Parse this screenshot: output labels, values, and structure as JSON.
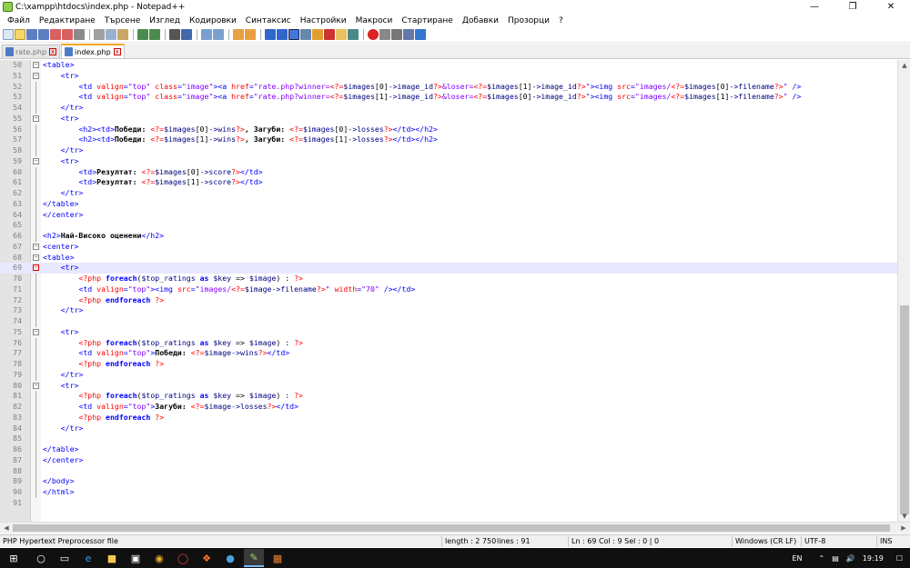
{
  "window": {
    "title": "C:\\xampp\\htdocs\\index.php - Notepad++"
  },
  "menu": [
    "Файл",
    "Редактиране",
    "Търсене",
    "Изглед",
    "Кодировки",
    "Синтаксис",
    "Настройки",
    "Макроси",
    "Стартиране",
    "Добавки",
    "Прозорци",
    "?"
  ],
  "tabs": [
    {
      "label": "rate.php"
    },
    {
      "label": "index.php"
    }
  ],
  "editor": {
    "current_line": 69,
    "lines": [
      {
        "n": "50",
        "h": "<span class=\"tag\">&lt;table&gt;</span>"
      },
      {
        "n": "51",
        "h": "    <span class=\"tag\">&lt;tr&gt;</span>"
      },
      {
        "n": "52",
        "h": "        <span class=\"tag\">&lt;td</span> <span class=\"attr\">valign</span><span class=\"tag\">=</span><span class=\"val\">\"top\"</span> <span class=\"attr\">class</span><span class=\"tag\">=</span><span class=\"val\">\"image\"</span><span class=\"tag\">&gt;&lt;a</span> <span class=\"attr\">href</span><span class=\"tag\">=</span><span class=\"val\">\"rate.php?winner=</span><span class=\"php\">&lt;?=</span><span class=\"var\">$images</span>[0]<span class=\"var\">-&gt;image_id</span><span class=\"php\">?&gt;</span><span class=\"val\">&amp;loser=</span><span class=\"php\">&lt;?=</span><span class=\"var\">$images</span>[1]<span class=\"var\">-&gt;image_id</span><span class=\"php\">?&gt;</span><span class=\"val\">\"</span><span class=\"tag\">&gt;&lt;img</span> <span class=\"attr\">src</span><span class=\"tag\">=</span><span class=\"val\">\"images/</span><span class=\"php\">&lt;?=</span><span class=\"var\">$images</span>[0]<span class=\"var\">-&gt;filename</span><span class=\"php\">?&gt;</span><span class=\"val\">\"</span> <span class=\"tag\">/&gt;</span>"
      },
      {
        "n": "53",
        "h": "        <span class=\"tag\">&lt;td</span> <span class=\"attr\">valign</span><span class=\"tag\">=</span><span class=\"val\">\"top\"</span> <span class=\"attr\">class</span><span class=\"tag\">=</span><span class=\"val\">\"image\"</span><span class=\"tag\">&gt;&lt;a</span> <span class=\"attr\">href</span><span class=\"tag\">=</span><span class=\"val\">\"rate.php?winner=</span><span class=\"php\">&lt;?=</span><span class=\"var\">$images</span>[1]<span class=\"var\">-&gt;image_id</span><span class=\"php\">?&gt;</span><span class=\"val\">&amp;loser=</span><span class=\"php\">&lt;?=</span><span class=\"var\">$images</span>[0]<span class=\"var\">-&gt;image_id</span><span class=\"php\">?&gt;</span><span class=\"val\">\"</span><span class=\"tag\">&gt;&lt;img</span> <span class=\"attr\">src</span><span class=\"tag\">=</span><span class=\"val\">\"images/</span><span class=\"php\">&lt;?=</span><span class=\"var\">$images</span>[1]<span class=\"var\">-&gt;filename</span><span class=\"php\">?&gt;</span><span class=\"val\">\"</span> <span class=\"tag\">/&gt;</span>"
      },
      {
        "n": "54",
        "h": "    <span class=\"tag\">&lt;/tr&gt;</span>"
      },
      {
        "n": "55",
        "h": "    <span class=\"tag\">&lt;tr&gt;</span>"
      },
      {
        "n": "56",
        "h": "        <span class=\"tag\">&lt;h2&gt;&lt;td&gt;</span><span class=\"txt\">Победи: </span><span class=\"php\">&lt;?=</span><span class=\"var\">$images</span>[0]<span class=\"var\">-&gt;wins</span><span class=\"php\">?&gt;</span><span class=\"txt\">, Загуби: </span><span class=\"php\">&lt;?=</span><span class=\"var\">$images</span>[0]<span class=\"var\">-&gt;losses</span><span class=\"php\">?&gt;</span><span class=\"tag\">&lt;/td&gt;&lt;/h2&gt;</span>"
      },
      {
        "n": "57",
        "h": "        <span class=\"tag\">&lt;h2&gt;&lt;td&gt;</span><span class=\"txt\">Победи: </span><span class=\"php\">&lt;?=</span><span class=\"var\">$images</span>[1]<span class=\"var\">-&gt;wins</span><span class=\"php\">?&gt;</span><span class=\"txt\">, Загуби: </span><span class=\"php\">&lt;?=</span><span class=\"var\">$images</span>[1]<span class=\"var\">-&gt;losses</span><span class=\"php\">?&gt;</span><span class=\"tag\">&lt;/td&gt;&lt;/h2&gt;</span>"
      },
      {
        "n": "58",
        "h": "    <span class=\"tag\">&lt;/tr&gt;</span>"
      },
      {
        "n": "59",
        "h": "    <span class=\"tag\">&lt;tr&gt;</span>"
      },
      {
        "n": "60",
        "h": "        <span class=\"tag\">&lt;td&gt;</span><span class=\"txt\">Резултат: </span><span class=\"php\">&lt;?=</span><span class=\"var\">$images</span>[0]<span class=\"var\">-&gt;score</span><span class=\"php\">?&gt;</span><span class=\"tag\">&lt;/td&gt;</span>"
      },
      {
        "n": "61",
        "h": "        <span class=\"tag\">&lt;td&gt;</span><span class=\"txt\">Резултат: </span><span class=\"php\">&lt;?=</span><span class=\"var\">$images</span>[1]<span class=\"var\">-&gt;score</span><span class=\"php\">?&gt;</span><span class=\"tag\">&lt;/td&gt;</span>"
      },
      {
        "n": "62",
        "h": "    <span class=\"tag\">&lt;/tr&gt;</span>"
      },
      {
        "n": "63",
        "h": "<span class=\"tag\">&lt;/table&gt;</span>"
      },
      {
        "n": "64",
        "h": "<span class=\"tag\">&lt;/center&gt;</span>"
      },
      {
        "n": "65",
        "h": ""
      },
      {
        "n": "66",
        "h": "<span class=\"tag\">&lt;h2&gt;</span><span class=\"txt\">Най-Високо оценени</span><span class=\"tag\">&lt;/h2&gt;</span>"
      },
      {
        "n": "67",
        "h": "<span class=\"tag\">&lt;center&gt;</span>"
      },
      {
        "n": "68",
        "h": "<span class=\"tag\">&lt;table&gt;</span>"
      },
      {
        "n": "69",
        "h": "    <span class=\"tag\">&lt;tr&gt;</span>"
      },
      {
        "n": "70",
        "h": "        <span class=\"php\">&lt;?php</span> <span class=\"kw\">foreach</span>(<span class=\"var\">$top_ratings</span> <span class=\"kw\">as</span> <span class=\"var\">$key</span> =&gt; <span class=\"var\">$image</span>) : <span class=\"php\">?&gt;</span>"
      },
      {
        "n": "71",
        "h": "        <span class=\"tag\">&lt;td</span> <span class=\"attr\">valign</span><span class=\"tag\">=</span><span class=\"val\">\"top\"</span><span class=\"tag\">&gt;&lt;img</span> <span class=\"attr\">src</span><span class=\"tag\">=</span><span class=\"val\">\"images/</span><span class=\"php\">&lt;?=</span><span class=\"var\">$image-&gt;filename</span><span class=\"php\">?&gt;</span><span class=\"val\">\"</span> <span class=\"attr\">width</span><span class=\"tag\">=</span><span class=\"val\">\"70\"</span> <span class=\"tag\">/&gt;&lt;/td&gt;</span>"
      },
      {
        "n": "72",
        "h": "        <span class=\"php\">&lt;?php</span> <span class=\"kw\">endforeach</span> <span class=\"php\">?&gt;</span>"
      },
      {
        "n": "73",
        "h": "    <span class=\"tag\">&lt;/tr&gt;</span>"
      },
      {
        "n": "74",
        "h": ""
      },
      {
        "n": "75",
        "h": "    <span class=\"tag\">&lt;tr&gt;</span>"
      },
      {
        "n": "76",
        "h": "        <span class=\"php\">&lt;?php</span> <span class=\"kw\">foreach</span>(<span class=\"var\">$top_ratings</span> <span class=\"kw\">as</span> <span class=\"var\">$key</span> =&gt; <span class=\"var\">$image</span>) : <span class=\"php\">?&gt;</span>"
      },
      {
        "n": "77",
        "h": "        <span class=\"tag\">&lt;td</span> <span class=\"attr\">valign</span><span class=\"tag\">=</span><span class=\"val\">\"top\"</span><span class=\"tag\">&gt;</span><span class=\"txt\">Победи: </span><span class=\"php\">&lt;?=</span><span class=\"var\">$image-&gt;wins</span><span class=\"php\">?&gt;</span><span class=\"tag\">&lt;/td&gt;</span>"
      },
      {
        "n": "78",
        "h": "        <span class=\"php\">&lt;?php</span> <span class=\"kw\">endforeach</span> <span class=\"php\">?&gt;</span>"
      },
      {
        "n": "79",
        "h": "    <span class=\"tag\">&lt;/tr&gt;</span>"
      },
      {
        "n": "80",
        "h": "    <span class=\"tag\">&lt;tr&gt;</span>"
      },
      {
        "n": "81",
        "h": "        <span class=\"php\">&lt;?php</span> <span class=\"kw\">foreach</span>(<span class=\"var\">$top_ratings</span> <span class=\"kw\">as</span> <span class=\"var\">$key</span> =&gt; <span class=\"var\">$image</span>) : <span class=\"php\">?&gt;</span>"
      },
      {
        "n": "82",
        "h": "        <span class=\"tag\">&lt;td</span> <span class=\"attr\">valign</span><span class=\"tag\">=</span><span class=\"val\">\"top\"</span><span class=\"tag\">&gt;</span><span class=\"txt\">Загуби: </span><span class=\"php\">&lt;?=</span><span class=\"var\">$image-&gt;losses</span><span class=\"php\">?&gt;</span><span class=\"tag\">&lt;/td&gt;</span>"
      },
      {
        "n": "83",
        "h": "        <span class=\"php\">&lt;?php</span> <span class=\"kw\">endforeach</span> <span class=\"php\">?&gt;</span>"
      },
      {
        "n": "84",
        "h": "    <span class=\"tag\">&lt;/tr&gt;</span>"
      },
      {
        "n": "85",
        "h": ""
      },
      {
        "n": "86",
        "h": "<span class=\"tag\">&lt;/table&gt;</span>"
      },
      {
        "n": "87",
        "h": "<span class=\"tag\">&lt;/center&gt;</span>"
      },
      {
        "n": "88",
        "h": ""
      },
      {
        "n": "89",
        "h": "<span class=\"tag\">&lt;/body&gt;</span>"
      },
      {
        "n": "90",
        "h": "<span class=\"tag\">&lt;/html&gt;</span>"
      },
      {
        "n": "91",
        "h": ""
      }
    ]
  },
  "status": {
    "filetype": "PHP Hypertext Preprocessor file",
    "length": "length : 2 750",
    "lines": "lines : 91",
    "position": "Ln : 69   Col : 9   Sel : 0 | 0",
    "eol": "Windows (CR LF)",
    "encoding": "UTF-8",
    "mode": "INS"
  },
  "taskbar": {
    "lang": "EN",
    "time": "19:19"
  }
}
